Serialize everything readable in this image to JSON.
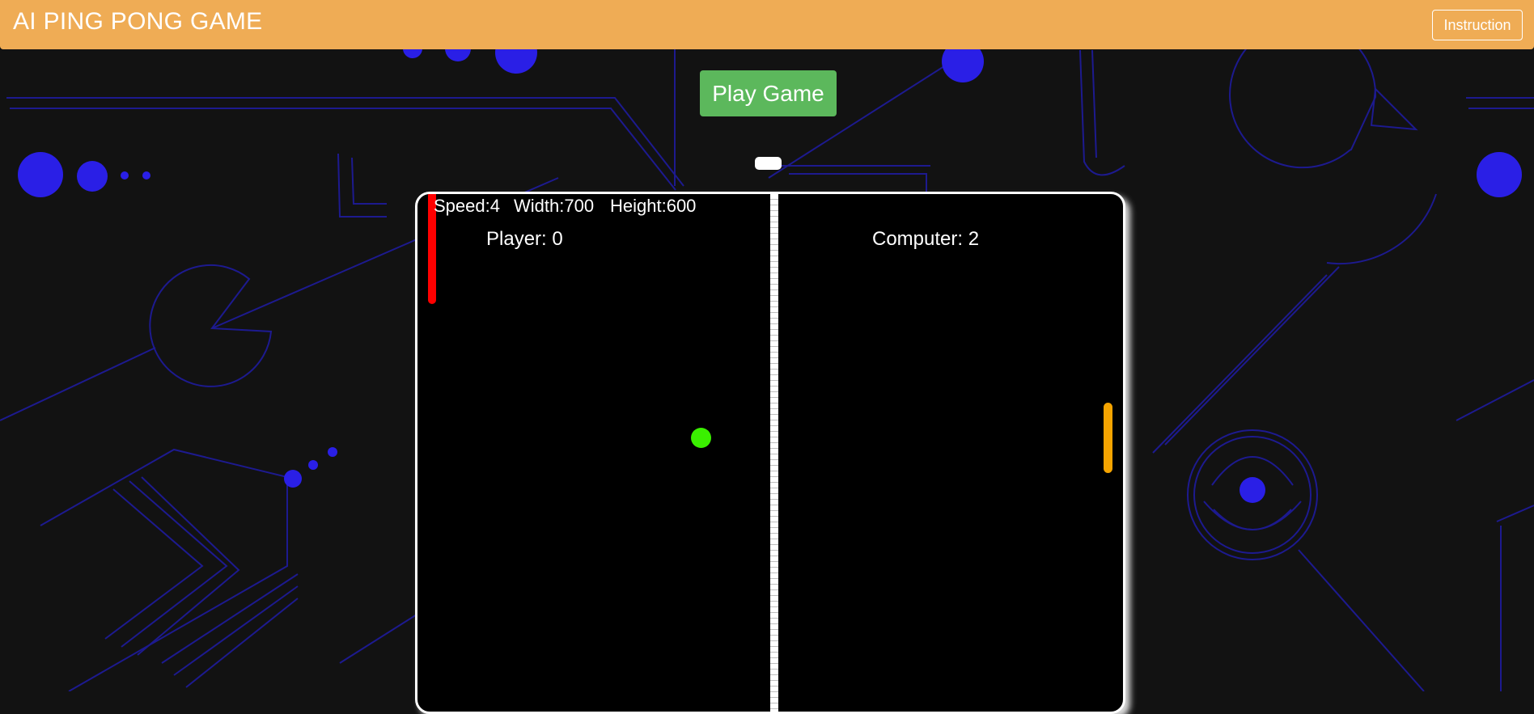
{
  "header": {
    "title": "AI PING PONG GAME",
    "instruction_label": "Instruction"
  },
  "controls": {
    "play_label": "Play Game"
  },
  "game": {
    "speed_text": "Speed:4",
    "width_text": "Width:700",
    "height_text": "Height:600",
    "player_score_text": "Player: 0",
    "computer_score_text": "Computer: 2",
    "speed": 4,
    "width": 700,
    "height": 600,
    "player_score": 0,
    "computer_score": 2
  },
  "colors": {
    "header_bg": "#efac55",
    "play_button": "#5cb85c",
    "player_paddle": "#ff0000",
    "computer_paddle": "#f5a400",
    "ball": "#3af000",
    "board_bg": "#000000",
    "background_lines": "#1d1a8f",
    "background_dots": "#2a1fe6"
  }
}
